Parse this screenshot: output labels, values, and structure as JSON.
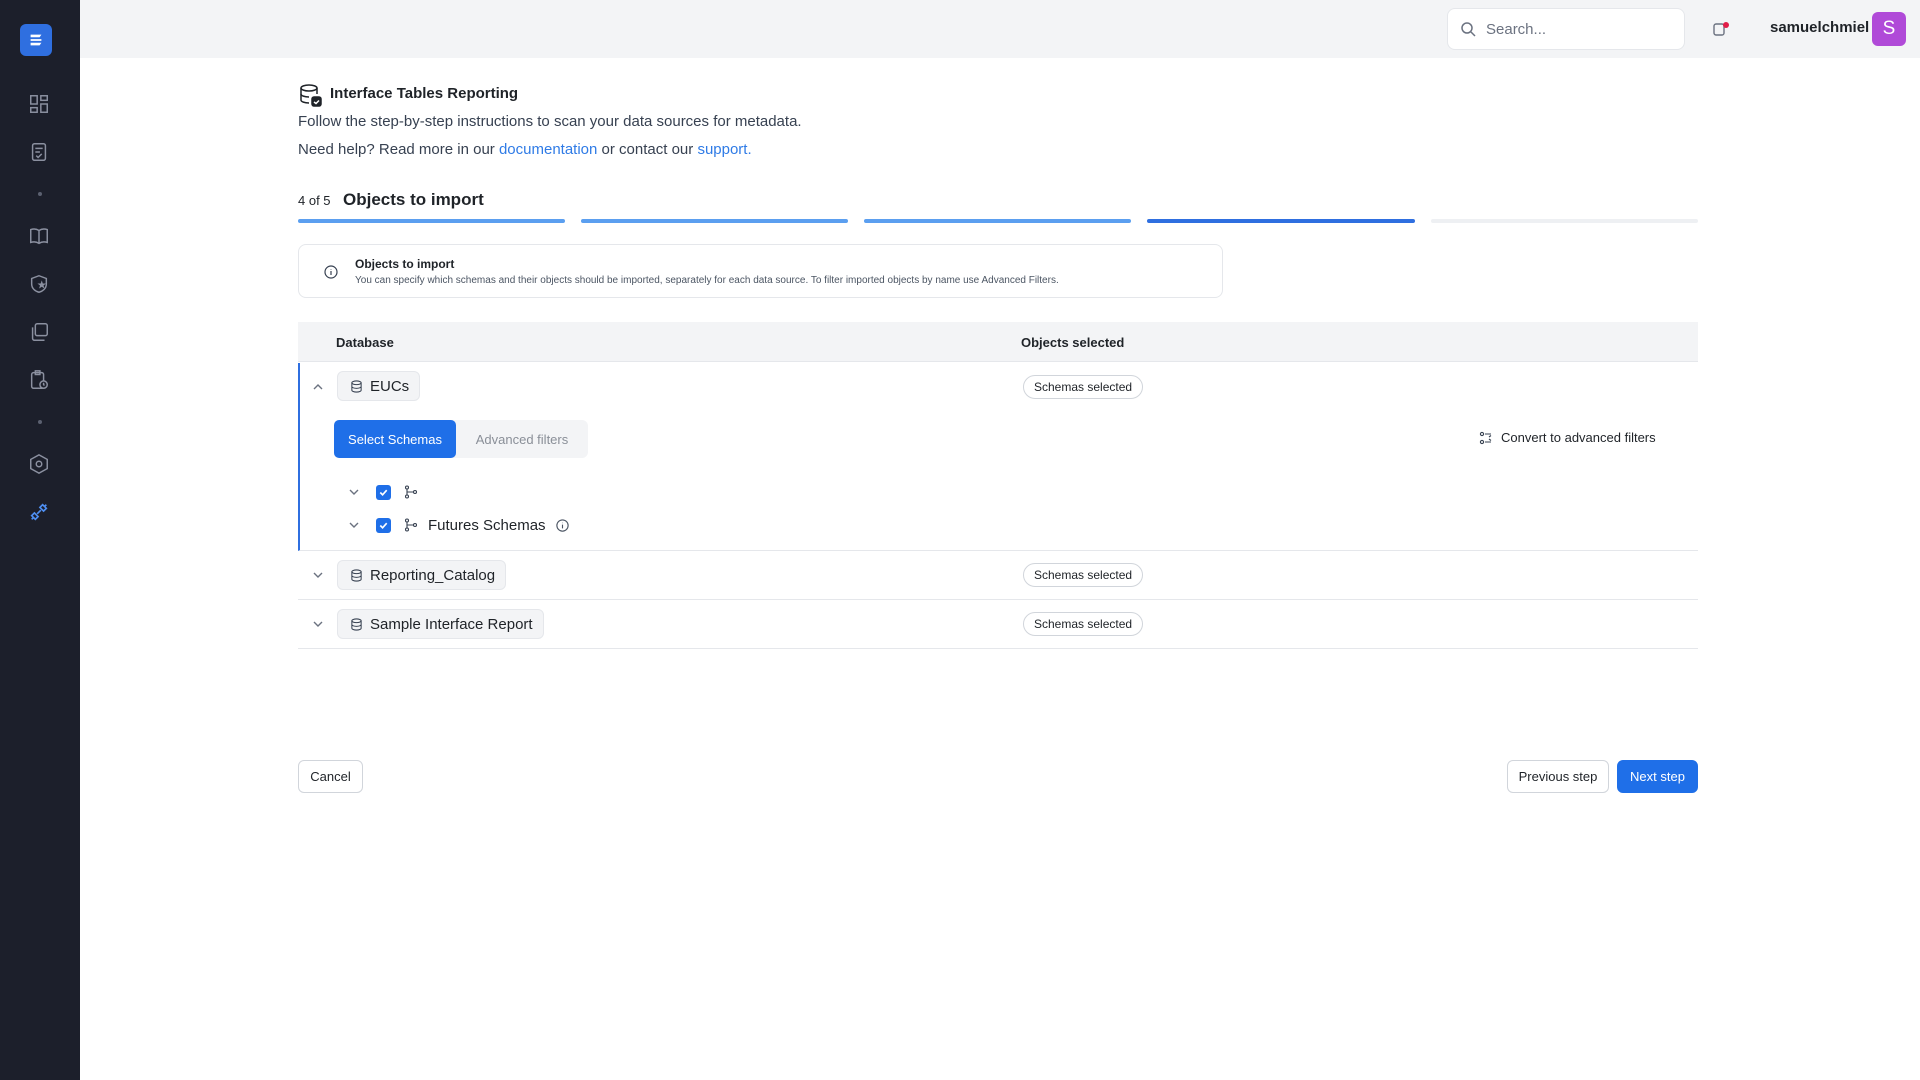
{
  "header": {
    "search_placeholder": "Search...",
    "username": "samuelchmiel",
    "avatar_initial": "S"
  },
  "page": {
    "title": "Interface Tables Reporting",
    "intro": "Follow the step-by-step instructions to scan your data sources for metadata.",
    "help_prefix": "Need help? Read more in our",
    "help_doc_link": "documentation",
    "help_middle": "or contact our",
    "help_support_link": "support."
  },
  "wizard": {
    "step_count": "4 of 5",
    "step_title": "Objects to import",
    "current_step": 4,
    "total_steps": 5
  },
  "info": {
    "title": "Objects to import",
    "text": "You can specify which schemas and their objects should be imported, separately for each data source. To filter imported objects by name use Advanced Filters."
  },
  "table": {
    "col_database": "Database",
    "col_objects": "Objects selected",
    "rows": [
      {
        "name": "EUCs",
        "badge": "Schemas selected",
        "tab_select": "Select Schemas",
        "tab_advanced": "Advanced filters",
        "convert": "Convert to advanced filters",
        "schemas": [
          {
            "name": "",
            "checked": true
          },
          {
            "name": "Futures Schemas",
            "checked": true
          }
        ]
      },
      {
        "name": "Reporting_Catalog",
        "badge": "Schemas selected"
      },
      {
        "name": "Sample Interface Report",
        "badge": "Schemas selected"
      }
    ]
  },
  "actions": {
    "cancel": "Cancel",
    "previous": "Previous step",
    "next": "Next step"
  },
  "colors": {
    "sidebar": "#1c1f2b",
    "primary": "#1f6fe8",
    "progress_done": "#5b9ff0",
    "progress_current": "#2f6fe0",
    "progress_todo": "#eef0f3",
    "link": "#2f7be6"
  }
}
